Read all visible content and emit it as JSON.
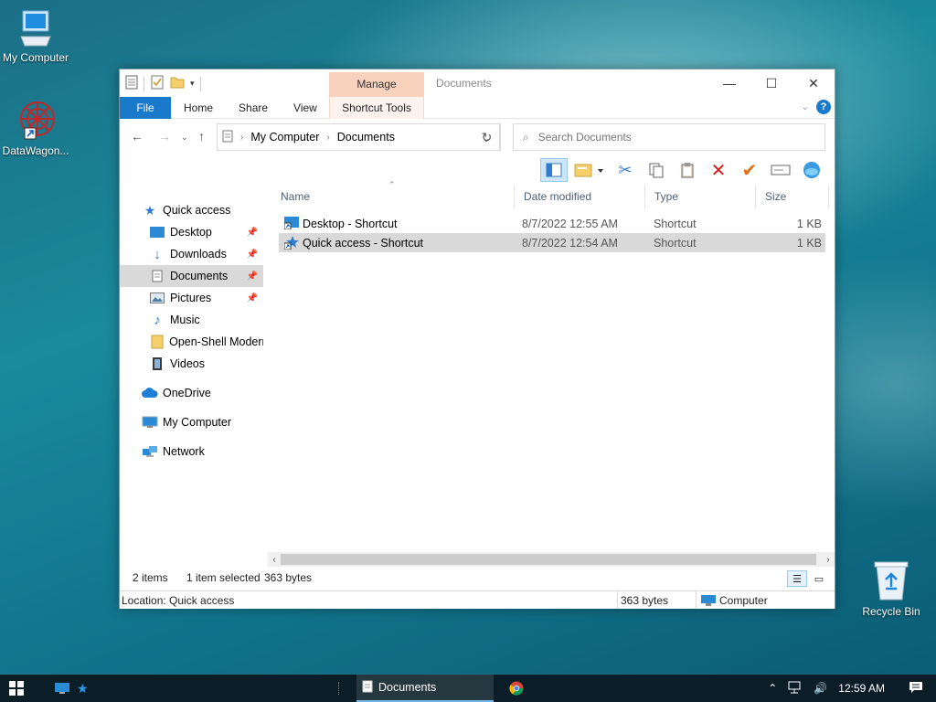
{
  "desktop": {
    "icons": [
      {
        "label": "My Computer"
      },
      {
        "label": "DataWagon..."
      },
      {
        "label": "Recycle Bin"
      }
    ]
  },
  "window": {
    "title": "Documents",
    "manage_tab": "Manage",
    "ribbon_tabs": [
      "File",
      "Home",
      "Share",
      "View"
    ],
    "contextual_tab": "Shortcut Tools",
    "help": "?"
  },
  "address": {
    "segments": [
      "My Computer",
      "Documents"
    ],
    "search_placeholder": "Search Documents"
  },
  "navpane": {
    "items": [
      {
        "label": "Quick access",
        "icon": "star-icon"
      },
      {
        "label": "Desktop",
        "icon": "desktop-icon",
        "pinned": true
      },
      {
        "label": "Downloads",
        "icon": "download-icon",
        "pinned": true
      },
      {
        "label": "Documents",
        "icon": "document-icon",
        "pinned": true,
        "selected": true
      },
      {
        "label": "Pictures",
        "icon": "picture-icon",
        "pinned": true
      },
      {
        "label": "Music",
        "icon": "music-icon"
      },
      {
        "label": "Open-Shell Modern",
        "icon": "folder-icon"
      },
      {
        "label": "Videos",
        "icon": "video-icon"
      },
      {
        "label": "OneDrive",
        "icon": "cloud-icon"
      },
      {
        "label": "My Computer",
        "icon": "computer-icon"
      },
      {
        "label": "Network",
        "icon": "network-icon"
      }
    ]
  },
  "filelist": {
    "columns": [
      "Name",
      "Date modified",
      "Type",
      "Size"
    ],
    "rows": [
      {
        "name": "Desktop - Shortcut",
        "date": "8/7/2022 12:55 AM",
        "type": "Shortcut",
        "size": "1 KB"
      },
      {
        "name": "Quick access - Shortcut",
        "date": "8/7/2022 12:54 AM",
        "type": "Shortcut",
        "size": "1 KB"
      }
    ]
  },
  "status": {
    "item_count": "2 items",
    "selected": "1 item selected",
    "selected_size": "363 bytes",
    "location": "Location: Quick access",
    "bottom_size": "363 bytes",
    "bottom_location": "Computer"
  },
  "taskbar": {
    "active_window": "Documents",
    "clock": "12:59 AM"
  },
  "colors": {
    "accent": "#1979ca",
    "manage_tab": "#f8d2bd",
    "selection": "#d9d9d9",
    "taskbar": "#0b1e28"
  }
}
